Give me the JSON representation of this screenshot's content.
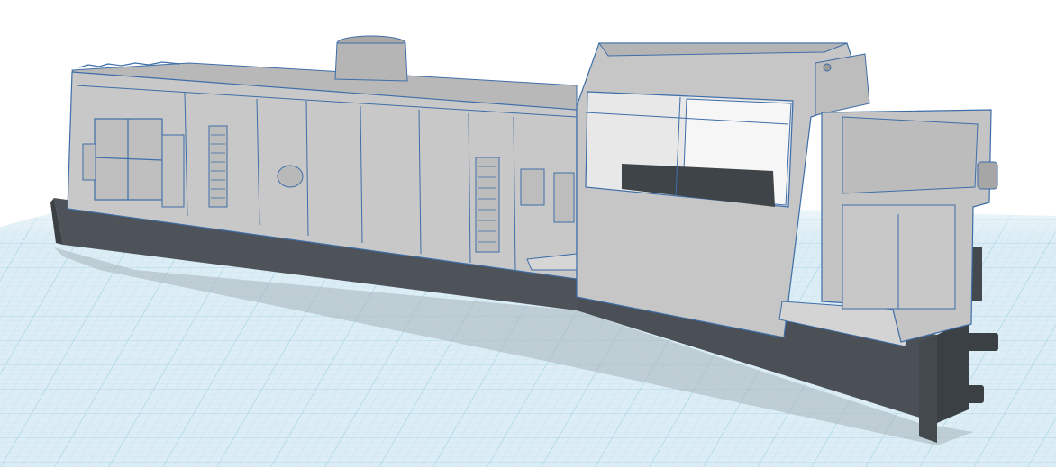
{
  "scene": {
    "description_visible_text": "",
    "colors": {
      "background": "#ffffff",
      "grid_fill": "#d9edf6",
      "grid_minor": "#c2e1ee",
      "grid_major": "#8cc8df",
      "body_light": "#c8c8c8",
      "body_mid": "#b3b3b3",
      "body_dark": "#9a9a9a",
      "frame": "#4d5358",
      "frame_dark": "#3b4044",
      "edge": "#3e6ea8",
      "shadow": "#9aa5ab"
    },
    "icons": [
      "locomotive-model",
      "workplane-grid"
    ]
  }
}
